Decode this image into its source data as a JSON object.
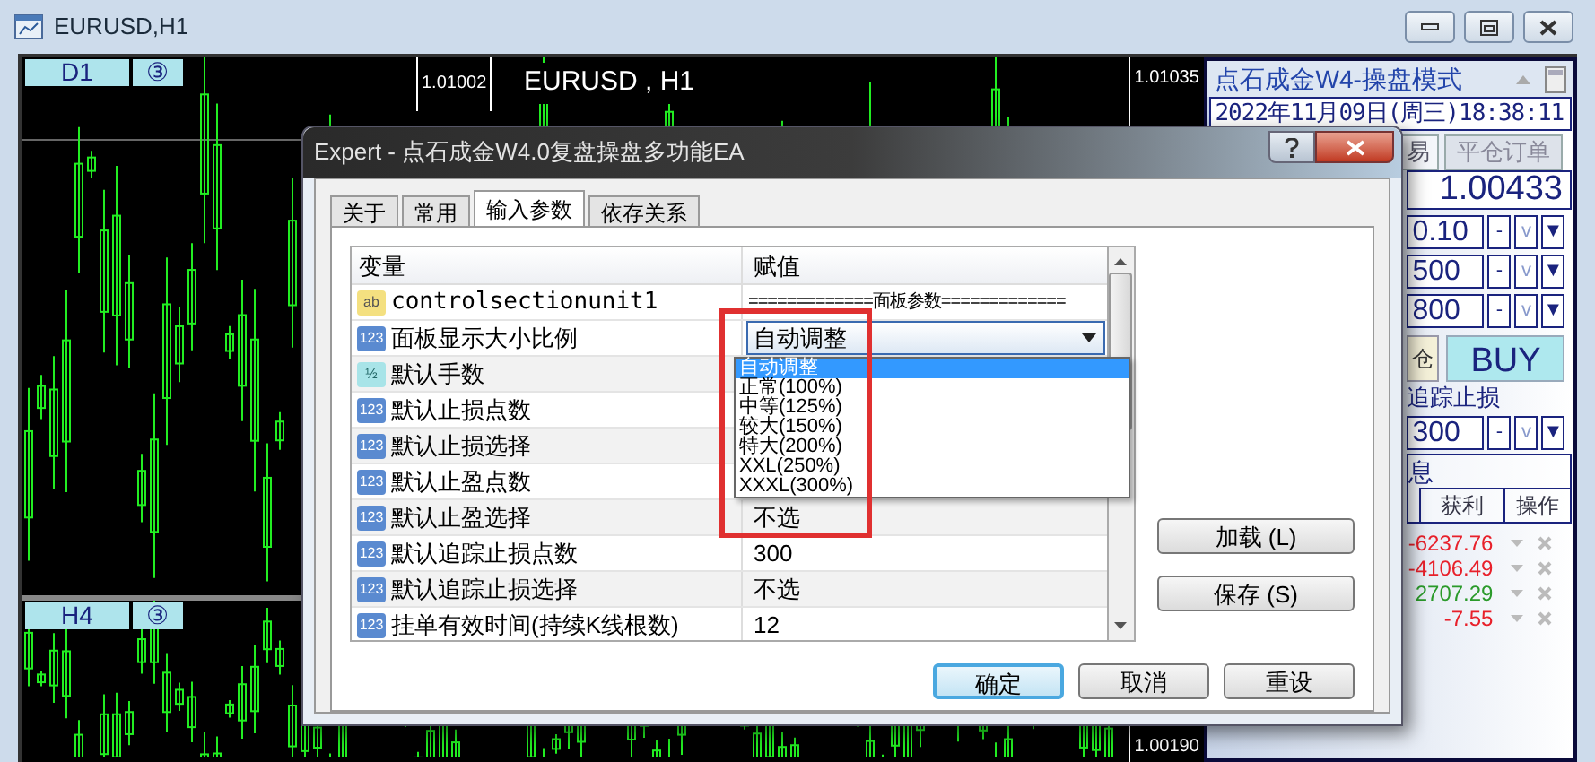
{
  "window": {
    "title": "EURUSD,H1"
  },
  "chart": {
    "symbol": "EURUSD , H1",
    "top_pane": {
      "timeframe": "D1",
      "badge": "③",
      "price_label": "1.01002",
      "axis_label": "1.01035"
    },
    "bottom_pane": {
      "timeframe": "H4",
      "badge": "③",
      "axis_label": "1.00190"
    }
  },
  "trade_panel": {
    "title": "点石成金W4-操盘模式",
    "datetime": "2022年11月09日(周三)18:38:11",
    "tabs": [
      {
        "label": "易",
        "selected": true
      },
      {
        "label": "平仓订单",
        "selected": false
      }
    ],
    "price": "1.00433",
    "spinners": [
      {
        "value": "0.10",
        "buttons": [
          "-",
          "v",
          "▼"
        ]
      },
      {
        "value": "500",
        "buttons": [
          "-",
          "v",
          "▼"
        ]
      },
      {
        "value": "800",
        "buttons": [
          "-",
          "v",
          "▼"
        ]
      }
    ],
    "close_button": "仓",
    "buy_button": "BUY",
    "trailing_label": "追踪止损",
    "trailing_spinner": {
      "value": "300",
      "buttons": [
        "-",
        "v",
        "▼"
      ]
    },
    "info_title": "息",
    "orders": {
      "columns": [
        "获利",
        "操作"
      ],
      "rows": [
        {
          "profit": "-6237.76",
          "color": "#e8202a"
        },
        {
          "profit": "-4106.49",
          "color": "#e8202a"
        },
        {
          "profit": "2707.29",
          "color": "#2a9a2a"
        },
        {
          "profit": "-7.55",
          "color": "#e8202a"
        }
      ]
    }
  },
  "dialog": {
    "title": "Expert - 点石成金W4.0复盘操盘多功能EA",
    "tabs": [
      {
        "label": "关于",
        "selected": false
      },
      {
        "label": "常用",
        "selected": false
      },
      {
        "label": "输入参数",
        "selected": true
      },
      {
        "label": "依存关系",
        "selected": false
      }
    ],
    "table": {
      "columns": [
        "变量",
        "赋值"
      ],
      "rows": [
        {
          "kind": "string",
          "icon": "ab",
          "name": "controlsectionunit1",
          "value": "=============面板参数============="
        },
        {
          "kind": "int",
          "icon": "123",
          "name": "面板显示大小比例",
          "value": "自动调整",
          "combo": true
        },
        {
          "kind": "double",
          "icon": "½",
          "name": "默认手数"
        },
        {
          "kind": "int",
          "icon": "123",
          "name": "默认止损点数"
        },
        {
          "kind": "int",
          "icon": "123",
          "name": "默认止损选择"
        },
        {
          "kind": "int",
          "icon": "123",
          "name": "默认止盈点数"
        },
        {
          "kind": "int",
          "icon": "123",
          "name": "默认止盈选择",
          "value": "不选"
        },
        {
          "kind": "int",
          "icon": "123",
          "name": "默认追踪止损点数",
          "value": "300"
        },
        {
          "kind": "int",
          "icon": "123",
          "name": "默认追踪止损选择",
          "value": "不选"
        },
        {
          "kind": "int",
          "icon": "123",
          "name": "挂单有效时间(持续K线根数)",
          "value": "12"
        }
      ]
    },
    "dropdown": {
      "options": [
        {
          "label": "自动调整",
          "selected": true
        },
        {
          "label": "正常(100%)",
          "selected": false
        },
        {
          "label": "中等(125%)",
          "selected": false
        },
        {
          "label": "较大(150%)",
          "selected": false
        },
        {
          "label": "特大(200%)",
          "selected": false
        },
        {
          "label": "XXL(250%)",
          "selected": false
        },
        {
          "label": "XXXL(300%)",
          "selected": false
        }
      ]
    },
    "side_buttons": [
      "加载 (L)",
      "保存 (S)"
    ],
    "buttons": [
      {
        "label": "确定",
        "default": true
      },
      {
        "label": "取消",
        "default": false
      },
      {
        "label": "重设",
        "default": false
      }
    ]
  }
}
